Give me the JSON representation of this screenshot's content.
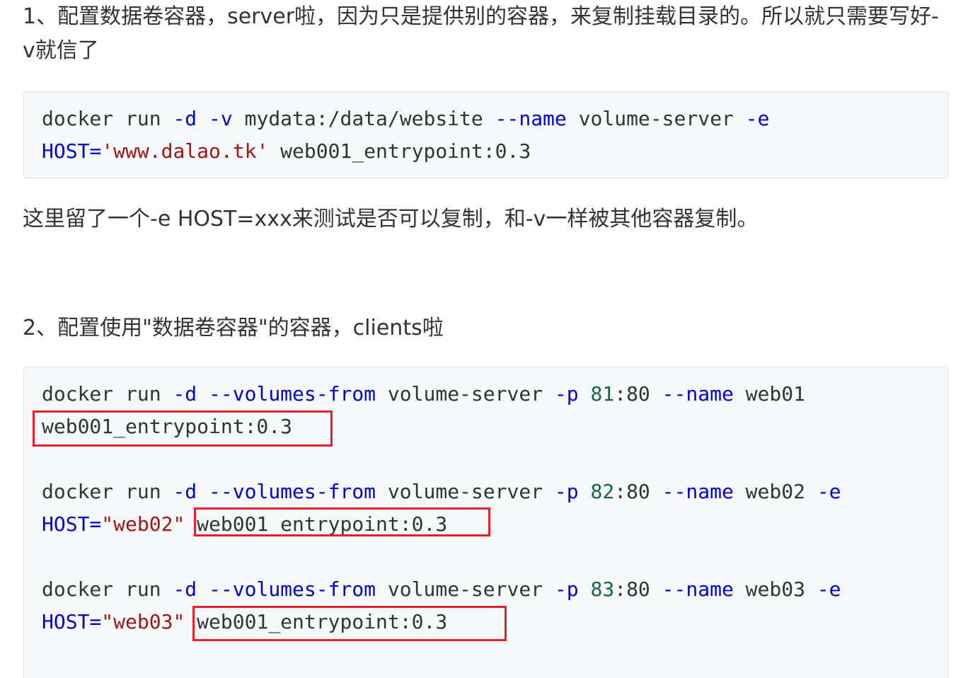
{
  "paragraphs": {
    "p1": "1、配置数据卷容器，server啦，因为只是提供别的容器，来复制挂载目录的。所以就只需要写好-v就信了",
    "p2": "这里留了一个-e HOST=xxx来测试是否可以复制，和-v一样被其他容器复制。",
    "p3": "2、配置使用\"数据卷容器\"的容器，clients啦"
  },
  "code1": {
    "l1": {
      "docker": "docker",
      "run": " run ",
      "d": "-d",
      "sp1": " ",
      "v": "-v",
      "path": " mydata:/data/website ",
      "name_flag": "--name",
      "server": " volume-server ",
      "e": "-e"
    },
    "l2": {
      "host": "HOST=",
      "value": "'www.dalao.tk'",
      "image": " web001_entrypoint:0.3"
    }
  },
  "code2": {
    "c1": {
      "docker": "docker",
      "run": " run ",
      "d": "-d",
      "sp1": " ",
      "vf": "--volumes-from",
      "server": " volume-server ",
      "p": "-p",
      "sp2": " ",
      "port": "81",
      "port_rest": ":80 ",
      "name_flag": "--name",
      "cname": " web01",
      "image": "web001_entrypoint:0.3"
    },
    "c2": {
      "docker": "docker",
      "run": " run ",
      "d": "-d",
      "sp1": " ",
      "vf": "--volumes-from",
      "server": " volume-server ",
      "p": "-p",
      "sp2": " ",
      "port": "82",
      "port_rest": ":80 ",
      "name_flag": "--name",
      "cname": " web02 ",
      "e": "-e",
      "host": "HOST=",
      "value": "\"web02\"",
      "sp3": " ",
      "image": "web001_entrypoint:0.3"
    },
    "c3": {
      "docker": "docker",
      "run": " run ",
      "d": "-d",
      "sp1": " ",
      "vf": "--volumes-from",
      "server": " volume-server ",
      "p": "-p",
      "sp2": " ",
      "port": "83",
      "port_rest": ":80 ",
      "name_flag": "--name",
      "cname": " web03 ",
      "e": "-e",
      "host": "HOST=",
      "value": "\"web03\"",
      "sp3": " ",
      "image": "web001_entrypoint:0.3"
    }
  },
  "colors": {
    "text": "#333333",
    "keyword": "#0000cc",
    "string": "#a31515",
    "number": "#116644",
    "highlight": "#e8202a",
    "code_bg": "#f6f8fa"
  }
}
